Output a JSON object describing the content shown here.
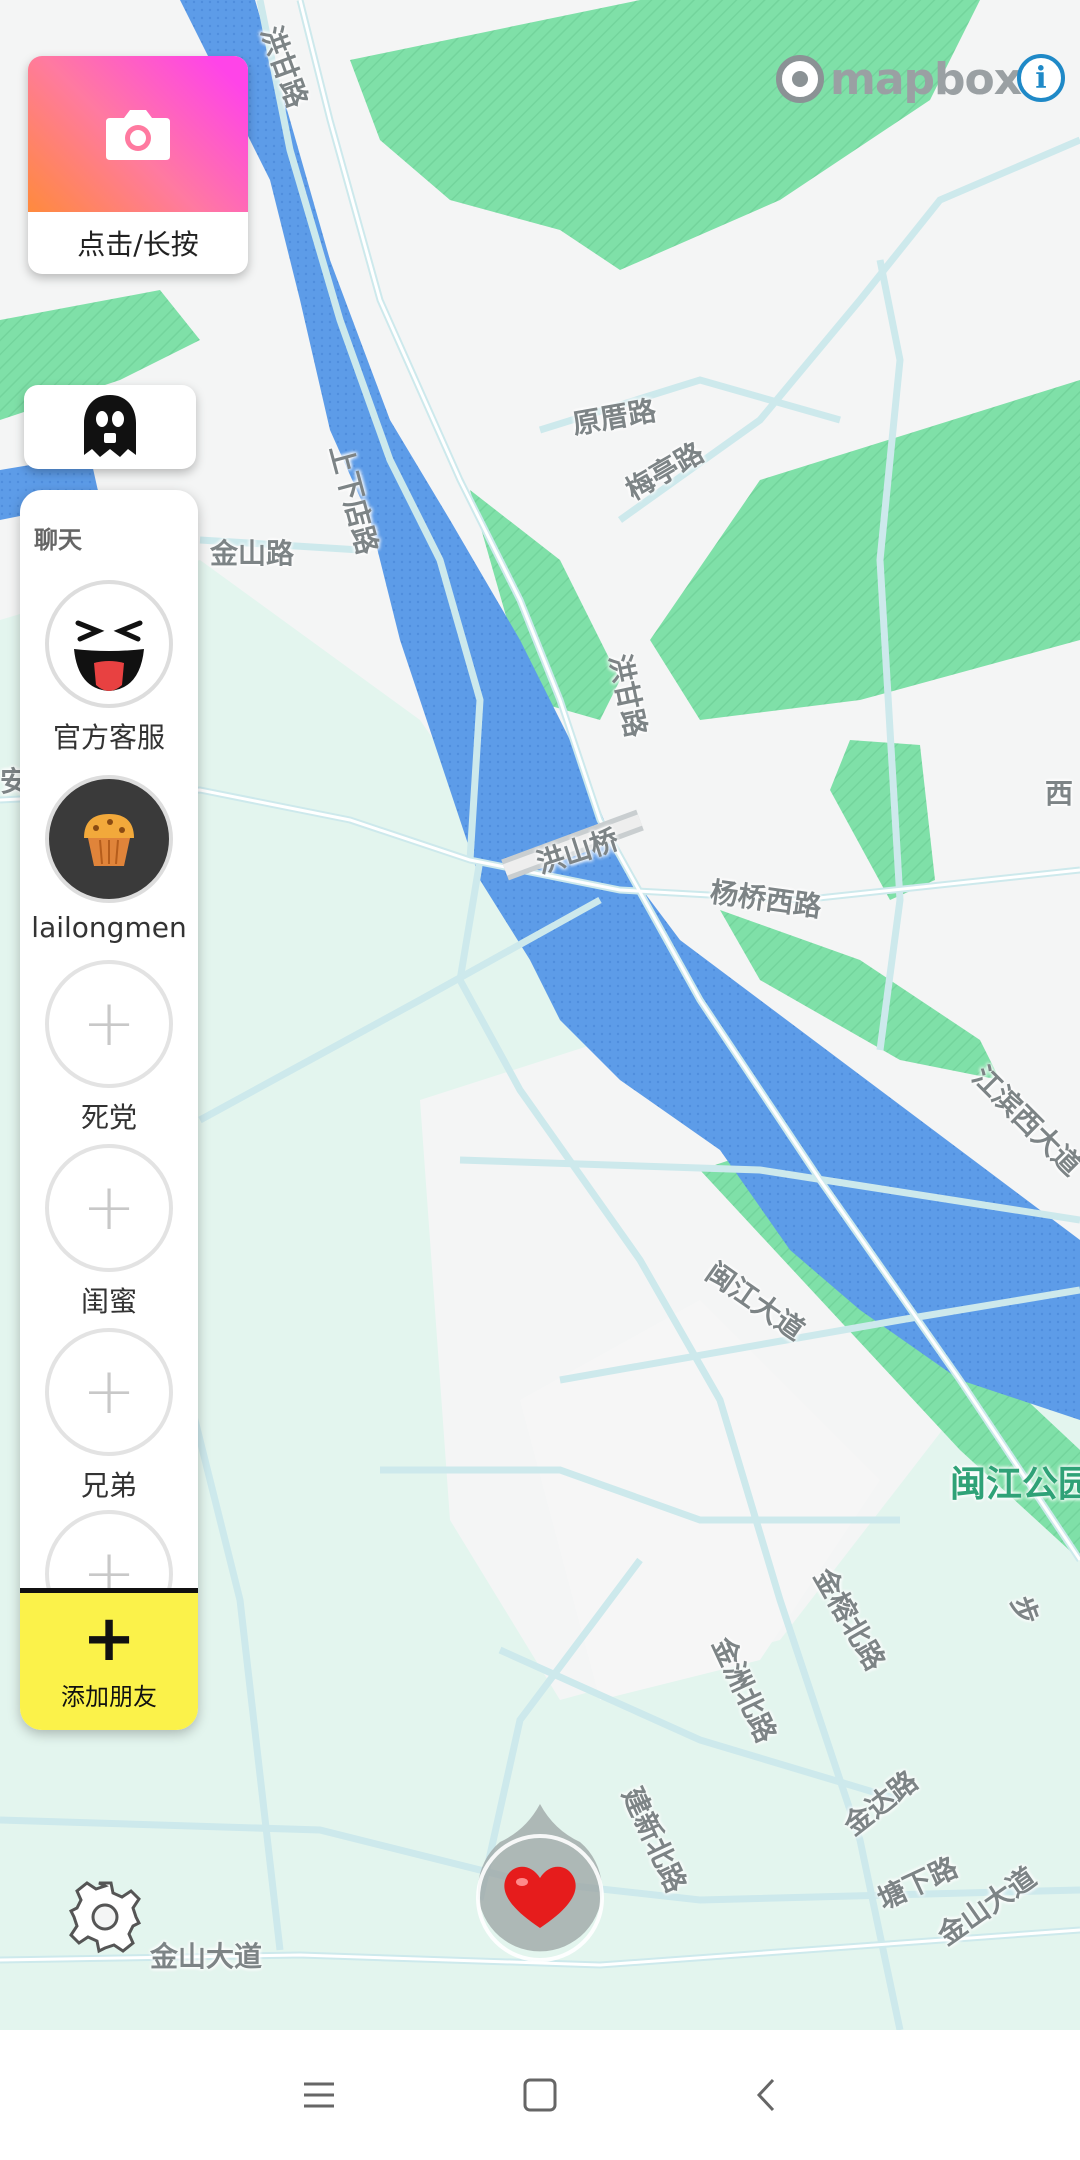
{
  "map": {
    "attribution": "mapbox",
    "info_icon": "info-icon",
    "labels": [
      {
        "id": "honggan-1",
        "text": "洪甘路"
      },
      {
        "id": "shangxiadian",
        "text": "上下店路"
      },
      {
        "id": "jinshan",
        "text": "金山路"
      },
      {
        "id": "yuanmei",
        "text": "原厝路"
      },
      {
        "id": "meiting",
        "text": "梅亭路"
      },
      {
        "id": "honggan-2",
        "text": "洪甘路"
      },
      {
        "id": "hongshan-bridge",
        "text": "洪山桥"
      },
      {
        "id": "yangqiao-west",
        "text": "杨桥西路"
      },
      {
        "id": "minjiang",
        "text": "闽江大道"
      },
      {
        "id": "jiangbin-west",
        "text": "江滨西大道"
      },
      {
        "id": "park",
        "text": "闽江公园"
      },
      {
        "id": "jinyu-north",
        "text": "金榕北路"
      },
      {
        "id": "jinyuan-north",
        "text": "金洲北路"
      },
      {
        "id": "jianxin-north",
        "text": "建新北路"
      },
      {
        "id": "jinda",
        "text": "金达路"
      },
      {
        "id": "tangxia",
        "text": "塘下路"
      },
      {
        "id": "jinshan-ave-1",
        "text": "金山大道"
      },
      {
        "id": "jinshan-ave-2",
        "text": "金山大道"
      },
      {
        "id": "xi-partial",
        "text": "西"
      },
      {
        "id": "bu-partial",
        "text": "步"
      },
      {
        "id": "an-partial",
        "text": "安"
      }
    ]
  },
  "camera": {
    "icon": "camera-icon",
    "label": "点击/长按"
  },
  "ghost": {
    "icon": "ghost-icon"
  },
  "friends": {
    "title": "聊天",
    "items": [
      {
        "name": "官方客服",
        "type": "smiley",
        "avatar_icon": "laughing-face-icon"
      },
      {
        "name": "lailongmen",
        "type": "dark",
        "avatar_icon": "muffin-icon"
      },
      {
        "name": "死党",
        "type": "empty",
        "avatar_icon": "plus-icon",
        "glyph": "+"
      },
      {
        "name": "闺蜜",
        "type": "empty",
        "avatar_icon": "plus-icon",
        "glyph": "+"
      },
      {
        "name": "兄弟",
        "type": "empty",
        "avatar_icon": "plus-icon",
        "glyph": "+"
      },
      {
        "name": "",
        "type": "empty",
        "avatar_icon": "plus-icon",
        "glyph": "+"
      }
    ],
    "add_button": {
      "glyph": "+",
      "label": "添加朋友"
    }
  },
  "controls": {
    "settings_icon": "gear-icon",
    "heart_icon": "heart-icon"
  },
  "nav": {
    "menu_icon": "menu-icon",
    "home_icon": "home-icon",
    "back_icon": "back-icon"
  },
  "colors": {
    "water": "#5d9ce8",
    "park": "#7fe0a8",
    "road": "#cde9ec",
    "land": "#f4f5f5",
    "add_button": "#fbf24a"
  }
}
